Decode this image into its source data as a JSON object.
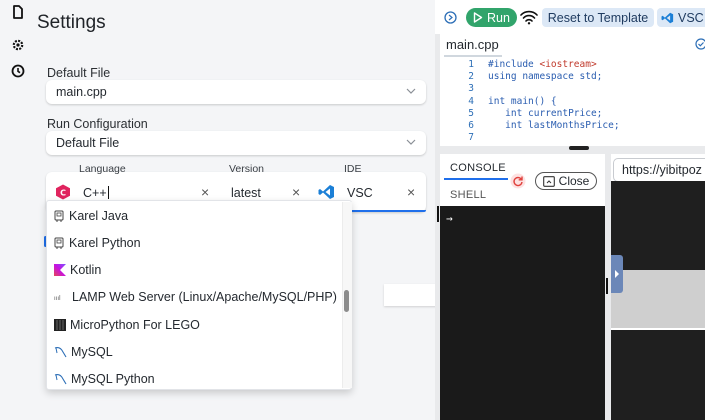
{
  "settings": {
    "title": "Settings",
    "default_file_label": "Default File",
    "default_file_value": "main.cpp",
    "run_config_label": "Run Configuration",
    "run_config_value": "Default File"
  },
  "combo": {
    "language_label": "Language",
    "language_value": "C++",
    "version_label": "Version",
    "version_value": "latest",
    "ide_label": "IDE",
    "ide_value": "VSC"
  },
  "language_options": [
    {
      "label": "Karel Java",
      "icon": "karel-icon"
    },
    {
      "label": "Karel Python",
      "icon": "karel-icon"
    },
    {
      "label": "Kotlin",
      "icon": "kotlin-icon"
    },
    {
      "label": "LAMP Web Server (Linux/Apache/MySQL/PHP)",
      "icon": "lamp-icon"
    },
    {
      "label": "MicroPython For LEGO",
      "icon": "lego-icon"
    },
    {
      "label": "MySQL",
      "icon": "mysql-icon"
    },
    {
      "label": "MySQL Python",
      "icon": "mysql-icon"
    }
  ],
  "toolbar": {
    "run_label": "Run",
    "reset_label": "Reset to Template",
    "vsc_label": "VSC"
  },
  "editor": {
    "file_tab": "main.cpp",
    "lines": [
      {
        "n": "1",
        "text": "#include <iostream>"
      },
      {
        "n": "2",
        "text": "using namespace std;"
      },
      {
        "n": "3",
        "text": ""
      },
      {
        "n": "4",
        "text": "int main() {"
      },
      {
        "n": "5",
        "text": "   int currentPrice;"
      },
      {
        "n": "6",
        "text": "   int lastMonthsPrice;"
      },
      {
        "n": "7",
        "text": ""
      }
    ]
  },
  "console": {
    "tab_console": "CONSOLE",
    "tab_shell": "SHELL",
    "close_label": "Close",
    "prompt": "→"
  },
  "preview": {
    "url": "https://yibitpoz"
  },
  "colors": {
    "run_green": "#31a46b",
    "accent_blue": "#1f6feb",
    "cpp_red": "#e0245e",
    "vsc_blue": "#1b7fd6"
  }
}
